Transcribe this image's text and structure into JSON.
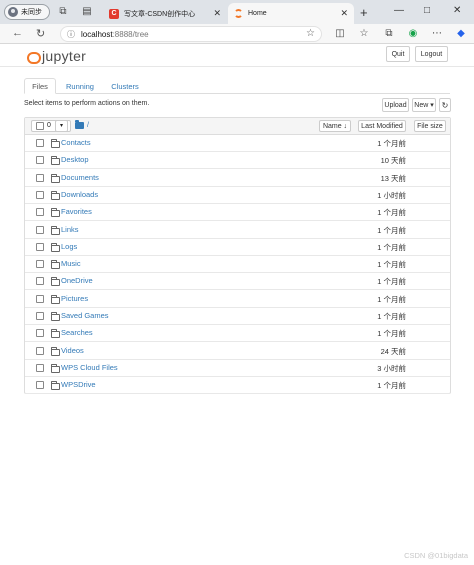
{
  "browser": {
    "profile_label": "未同步",
    "tabs": [
      {
        "title": "写文章-CSDN创作中心",
        "active": false,
        "favicon": "csdn-icon"
      },
      {
        "title": "Home",
        "active": true,
        "favicon": "jupyter-icon"
      }
    ],
    "new_tab_glyph": "+",
    "window_controls": [
      "—",
      "□",
      "✕"
    ],
    "url_host": "localhost",
    "url_rest": ":8888/tree"
  },
  "header": {
    "logo_text": "jupyter",
    "quit_label": "Quit",
    "logout_label": "Logout"
  },
  "tabs": [
    "Files",
    "Running",
    "Clusters"
  ],
  "instructions": "Select items to perform actions on them.",
  "actions": {
    "upload": "Upload",
    "new": "New ▾",
    "refresh_icon": "refresh-icon"
  },
  "list_header": {
    "selected_count": "0",
    "breadcrumb": "/",
    "name_label": "Name ↓",
    "last_modified_label": "Last Modified",
    "file_size_label": "File size"
  },
  "items": [
    {
      "name": "Contacts",
      "modified": "1 个月前"
    },
    {
      "name": "Desktop",
      "modified": "10 天前"
    },
    {
      "name": "Documents",
      "modified": "13 天前"
    },
    {
      "name": "Downloads",
      "modified": "1 小时前"
    },
    {
      "name": "Favorites",
      "modified": "1 个月前"
    },
    {
      "name": "Links",
      "modified": "1 个月前"
    },
    {
      "name": "Logs",
      "modified": "1 个月前"
    },
    {
      "name": "Music",
      "modified": "1 个月前"
    },
    {
      "name": "OneDrive",
      "modified": "1 个月前"
    },
    {
      "name": "Pictures",
      "modified": "1 个月前"
    },
    {
      "name": "Saved Games",
      "modified": "1 个月前"
    },
    {
      "name": "Searches",
      "modified": "1 个月前"
    },
    {
      "name": "Videos",
      "modified": "24 天前"
    },
    {
      "name": "WPS Cloud Files",
      "modified": "3 小时前"
    },
    {
      "name": "WPSDrive",
      "modified": "1 个月前"
    }
  ],
  "watermark": "CSDN @01bigdata",
  "colors": {
    "link": "#337ab7",
    "accent": "#f37726"
  }
}
